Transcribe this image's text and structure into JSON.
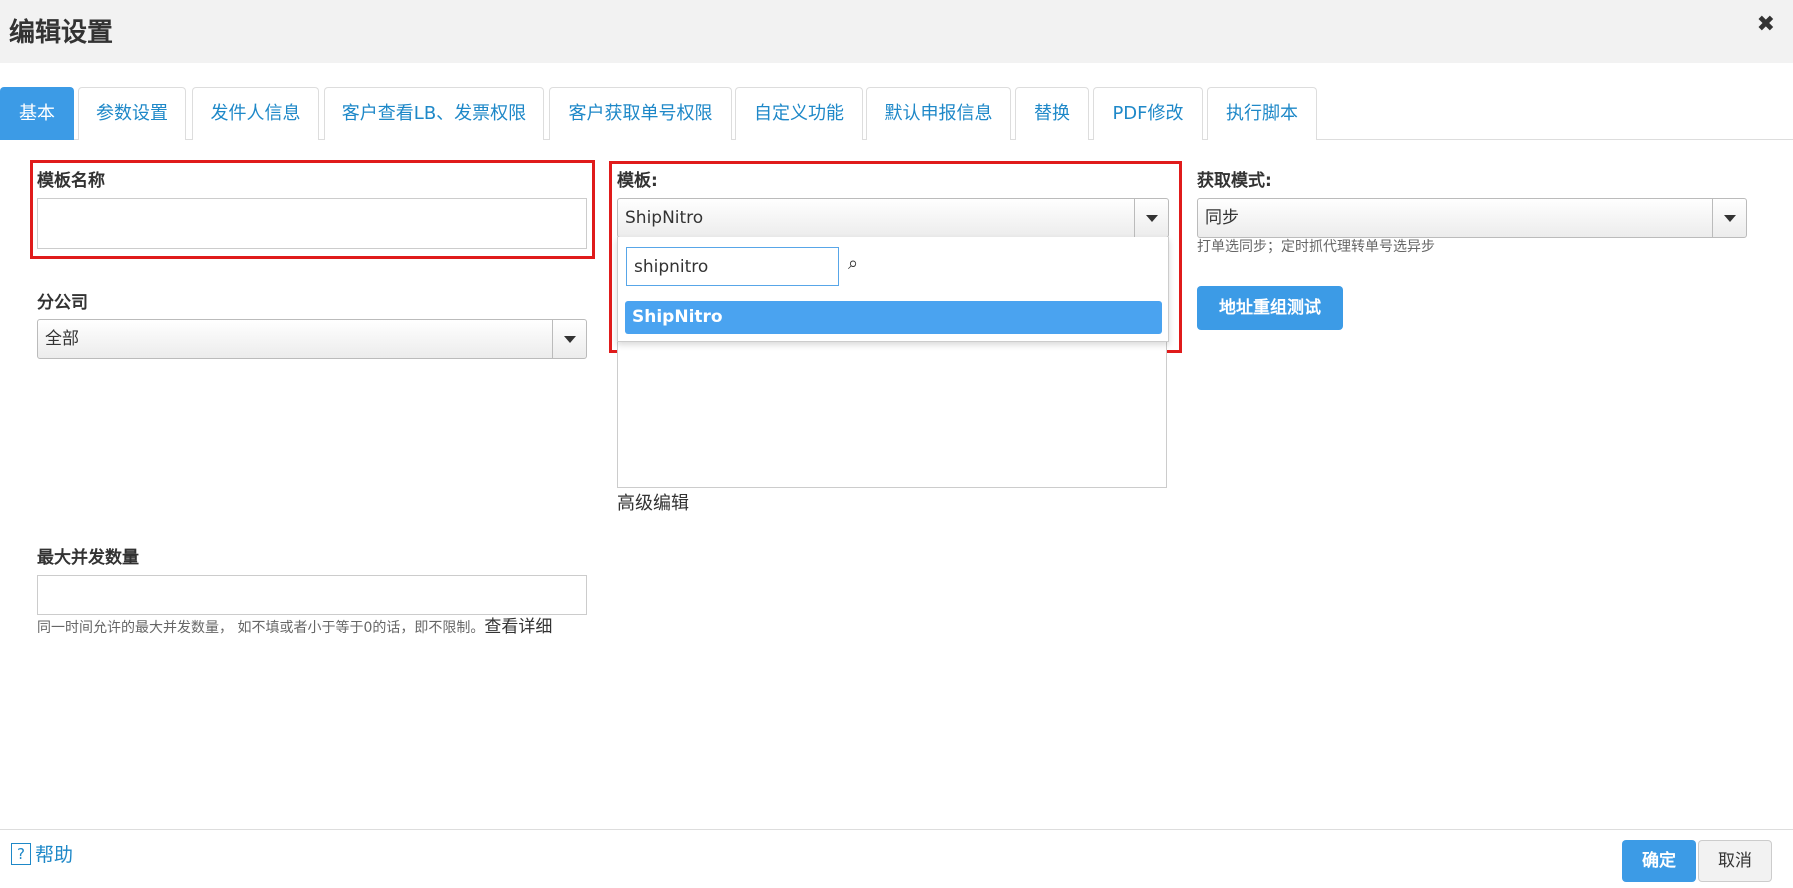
{
  "dialog": {
    "title": "编辑设置",
    "close_icon": "close-icon"
  },
  "tabs": [
    {
      "label": "基本",
      "active": true
    },
    {
      "label": "参数设置"
    },
    {
      "label": "发件人信息"
    },
    {
      "label": "客户查看LB、发票权限"
    },
    {
      "label": "客户获取单号权限"
    },
    {
      "label": "自定义功能"
    },
    {
      "label": "默认申报信息"
    },
    {
      "label": "替换"
    },
    {
      "label": "PDF修改"
    },
    {
      "label": "执行脚本"
    }
  ],
  "form": {
    "template_name": {
      "label": "模板名称",
      "value": ""
    },
    "branch": {
      "label": "分公司",
      "value": "全部"
    },
    "max_concurrency": {
      "label": "最大并发数量",
      "value": "",
      "hint": "同一时间允许的最大并发数量， 如不填或者小于等于0的话，即不限制。",
      "more_link": "查看详细"
    },
    "template": {
      "label": "模板:",
      "value": "ShipNitro",
      "search_value": "shipnitro",
      "options": [
        "ShipNitro"
      ],
      "advanced_edit": "高级编辑"
    },
    "fetch_mode": {
      "label": "获取模式:",
      "value": "同步",
      "hint": "打单选同步；定时抓代理转单号选异步"
    },
    "address_test_button": "地址重组测试"
  },
  "footer": {
    "help": "帮助",
    "help_icon": "question-icon",
    "ok": "确定",
    "cancel": "取消"
  },
  "colors": {
    "accent": "#3c9be6",
    "link": "#1e88c8",
    "highlight_box": "#e01b1b"
  }
}
